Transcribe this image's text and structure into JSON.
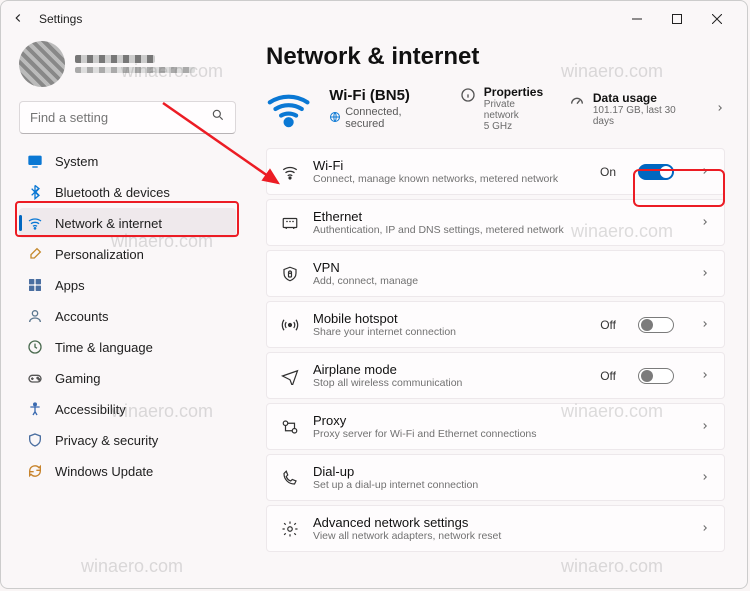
{
  "window": {
    "title": "Settings"
  },
  "user": {
    "name_redacted": true
  },
  "search": {
    "placeholder": "Find a setting"
  },
  "sidebar": {
    "items": [
      {
        "label": "System",
        "icon": "display"
      },
      {
        "label": "Bluetooth & devices",
        "icon": "bluetooth"
      },
      {
        "label": "Network & internet",
        "icon": "wifi",
        "active": true
      },
      {
        "label": "Personalization",
        "icon": "brush"
      },
      {
        "label": "Apps",
        "icon": "grid"
      },
      {
        "label": "Accounts",
        "icon": "person"
      },
      {
        "label": "Time & language",
        "icon": "clock"
      },
      {
        "label": "Gaming",
        "icon": "gaming"
      },
      {
        "label": "Accessibility",
        "icon": "accessibility"
      },
      {
        "label": "Privacy & security",
        "icon": "shield"
      },
      {
        "label": "Windows Update",
        "icon": "update"
      }
    ]
  },
  "page": {
    "title": "Network & internet",
    "hero": {
      "ssid": "Wi-Fi (BN5)",
      "status": "Connected, secured",
      "properties": {
        "title": "Properties",
        "sub": "Private network\n5 GHz"
      },
      "data_usage": {
        "title": "Data usage",
        "sub": "101.17 GB, last 30 days"
      }
    },
    "cards": [
      {
        "title": "Wi-Fi",
        "sub": "Connect, manage known networks, metered network",
        "icon": "wifi",
        "state_label": "On",
        "toggle": "on"
      },
      {
        "title": "Ethernet",
        "sub": "Authentication, IP and DNS settings, metered network",
        "icon": "ethernet"
      },
      {
        "title": "VPN",
        "sub": "Add, connect, manage",
        "icon": "vpn"
      },
      {
        "title": "Mobile hotspot",
        "sub": "Share your internet connection",
        "icon": "hotspot",
        "state_label": "Off",
        "toggle": "off"
      },
      {
        "title": "Airplane mode",
        "sub": "Stop all wireless communication",
        "icon": "airplane",
        "state_label": "Off",
        "toggle": "off"
      },
      {
        "title": "Proxy",
        "sub": "Proxy server for Wi-Fi and Ethernet connections",
        "icon": "proxy"
      },
      {
        "title": "Dial-up",
        "sub": "Set up a dial-up internet connection",
        "icon": "dialup"
      },
      {
        "title": "Advanced network settings",
        "sub": "View all network adapters, network reset",
        "icon": "settings"
      }
    ]
  },
  "watermark": "winaero.com"
}
